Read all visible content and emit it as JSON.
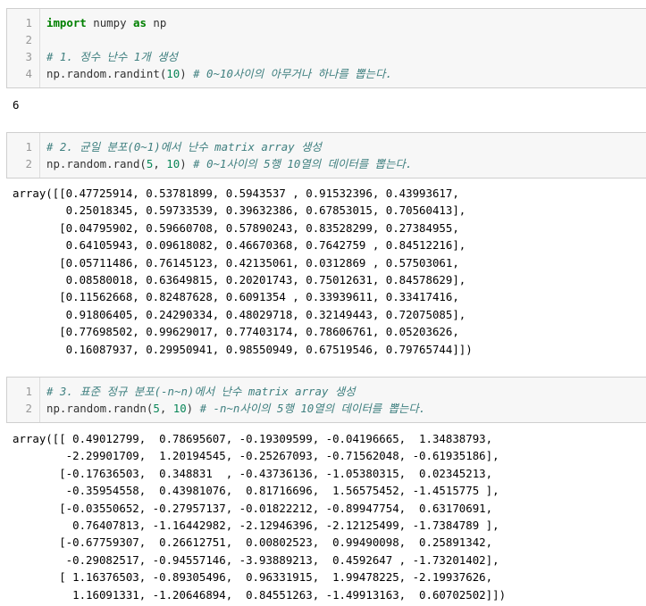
{
  "cells": [
    {
      "line_numbers": [
        "1",
        "2",
        "3",
        "4"
      ],
      "code": {
        "import_kw": "import",
        "import_mod": "numpy",
        "as_kw": "as",
        "import_alias": "np",
        "comment1": "# 1. 정수 난수 1개 생성",
        "call_pre": "np.random.randint(",
        "arg": "10",
        "call_post": ")",
        "comment2": "# 0~10사이의 아무거나 하나를 뽑는다."
      },
      "output": "6"
    },
    {
      "line_numbers": [
        "1",
        "2"
      ],
      "code": {
        "comment1": "# 2. 균일 분포(0~1)에서 난수 matrix array 생성",
        "call_pre": "np.random.rand(",
        "arg1": "5",
        "sep": ", ",
        "arg2": "10",
        "call_post": ")",
        "comment2": "# 0~1사이의 5행 10열의 데이터를 뽑는다."
      },
      "output": "array([[0.47725914, 0.53781899, 0.5943537 , 0.91532396, 0.43993617,\n        0.25018345, 0.59733539, 0.39632386, 0.67853015, 0.70560413],\n       [0.04795902, 0.59660708, 0.57890243, 0.83528299, 0.27384955,\n        0.64105943, 0.09618082, 0.46670368, 0.7642759 , 0.84512216],\n       [0.05711486, 0.76145123, 0.42135061, 0.0312869 , 0.57503061,\n        0.08580018, 0.63649815, 0.20201743, 0.75012631, 0.84578629],\n       [0.11562668, 0.82487628, 0.6091354 , 0.33939611, 0.33417416,\n        0.91806405, 0.24290334, 0.48029718, 0.32149443, 0.72075085],\n       [0.77698502, 0.99629017, 0.77403174, 0.78606761, 0.05203626,\n        0.16087937, 0.29950941, 0.98550949, 0.67519546, 0.79765744]])"
    },
    {
      "line_numbers": [
        "1",
        "2"
      ],
      "code": {
        "comment1": "# 3. 표준 정규 분포(-n~n)에서 난수 matrix array 생성",
        "call_pre": "np.random.randn(",
        "arg1": "5",
        "sep": ", ",
        "arg2": "10",
        "call_post": ")",
        "comment2": "# -n~n사이의 5행 10열의 데이터를 뽑는다."
      },
      "output": "array([[ 0.49012799,  0.78695607, -0.19309599, -0.04196665,  1.34838793,\n        -2.29901709,  1.20194545, -0.25267093, -0.71562048, -0.61935186],\n       [-0.17636503,  0.348831  , -0.43736136, -1.05380315,  0.02345213,\n        -0.35954558,  0.43981076,  0.81716696,  1.56575452, -1.4515775 ],\n       [-0.03550652, -0.27957137, -0.01822212, -0.89947754,  0.63170691,\n         0.76407813, -1.16442982, -2.12946396, -2.12125499, -1.7384789 ],\n       [-0.67759307,  0.26612751,  0.00802523,  0.99490098,  0.25891342,\n        -0.29082517, -0.94557146, -3.93889213,  0.4592647 , -1.73201402],\n       [ 1.16376503, -0.89305496,  0.96331915,  1.99478225, -2.19937626,\n         1.16091331, -1.20646894,  0.84551263, -1.49913163,  0.60702502]])"
    }
  ]
}
